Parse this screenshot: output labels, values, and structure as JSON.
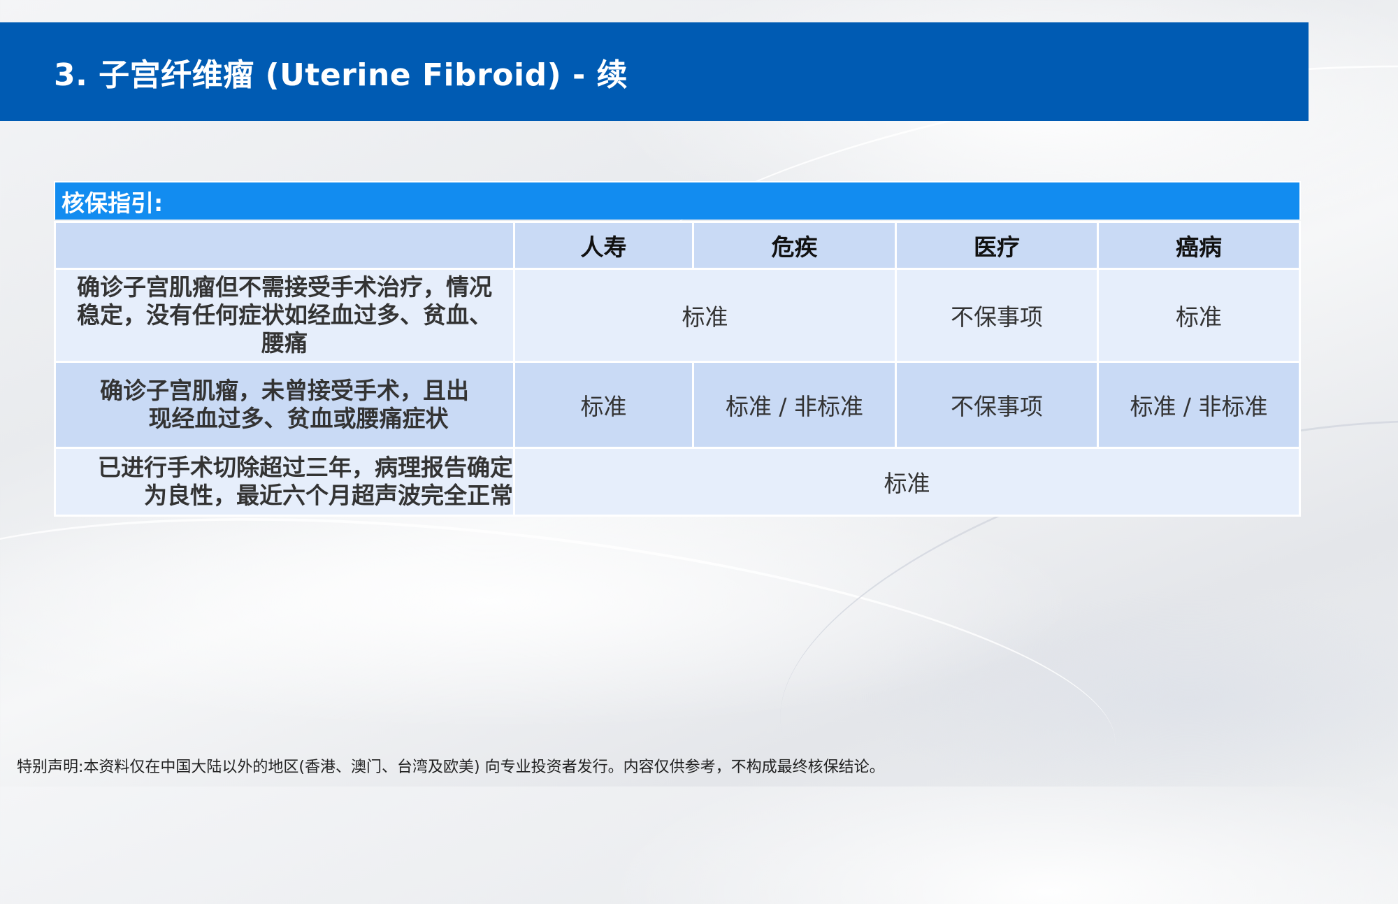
{
  "title": "3. 子宫纤维瘤 (Uterine Fibroid) - 续",
  "guide_label": "核保指引:",
  "table": {
    "headers": [
      "",
      "人寿",
      "危疾",
      "医疗",
      "癌病"
    ],
    "rows": [
      {
        "condition_lines": [
          "确诊子宫肌瘤但不需接受手术治疗，情况",
          "稳定，没有任何症状如经血过多、贫血、",
          "腰痛"
        ],
        "life_and_ci": "标准",
        "medical": "不保事项",
        "cancer": "标准"
      },
      {
        "condition_lines": [
          "确诊子宫肌瘤，未曾接受手术，且出",
          "现经血过多、贫血或腰痛症状"
        ],
        "life": "标准",
        "ci": "标准 / 非标准",
        "medical": "不保事项",
        "cancer": "标准 / 非标准"
      },
      {
        "condition_lines": [
          "已进行手术切除超过三年，病理报告确定",
          "为良性，最近六个月超声波完全正常"
        ],
        "all": "标准"
      }
    ]
  },
  "disclaimer": "特别声明:本资料仅在中国大陆以外的地区(香港、澳门、台湾及欧美) 向专业投资者发行。内容仅供参考，不构成最终核保结论。"
}
